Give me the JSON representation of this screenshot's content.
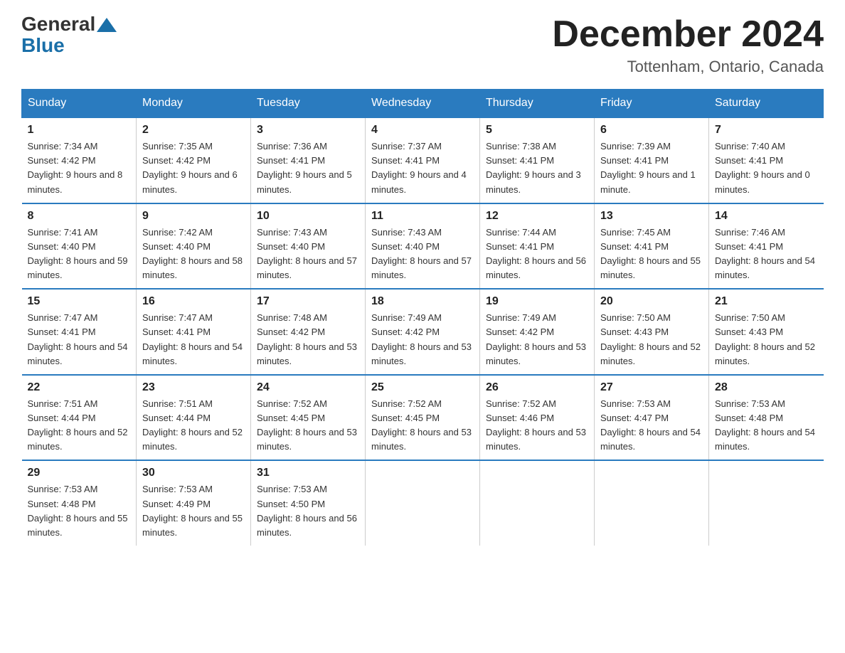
{
  "logo": {
    "general": "General",
    "blue": "Blue"
  },
  "title": "December 2024",
  "location": "Tottenham, Ontario, Canada",
  "days_of_week": [
    "Sunday",
    "Monday",
    "Tuesday",
    "Wednesday",
    "Thursday",
    "Friday",
    "Saturday"
  ],
  "weeks": [
    [
      {
        "day": "1",
        "sunrise": "7:34 AM",
        "sunset": "4:42 PM",
        "daylight": "9 hours and 8 minutes."
      },
      {
        "day": "2",
        "sunrise": "7:35 AM",
        "sunset": "4:42 PM",
        "daylight": "9 hours and 6 minutes."
      },
      {
        "day": "3",
        "sunrise": "7:36 AM",
        "sunset": "4:41 PM",
        "daylight": "9 hours and 5 minutes."
      },
      {
        "day": "4",
        "sunrise": "7:37 AM",
        "sunset": "4:41 PM",
        "daylight": "9 hours and 4 minutes."
      },
      {
        "day": "5",
        "sunrise": "7:38 AM",
        "sunset": "4:41 PM",
        "daylight": "9 hours and 3 minutes."
      },
      {
        "day": "6",
        "sunrise": "7:39 AM",
        "sunset": "4:41 PM",
        "daylight": "9 hours and 1 minute."
      },
      {
        "day": "7",
        "sunrise": "7:40 AM",
        "sunset": "4:41 PM",
        "daylight": "9 hours and 0 minutes."
      }
    ],
    [
      {
        "day": "8",
        "sunrise": "7:41 AM",
        "sunset": "4:40 PM",
        "daylight": "8 hours and 59 minutes."
      },
      {
        "day": "9",
        "sunrise": "7:42 AM",
        "sunset": "4:40 PM",
        "daylight": "8 hours and 58 minutes."
      },
      {
        "day": "10",
        "sunrise": "7:43 AM",
        "sunset": "4:40 PM",
        "daylight": "8 hours and 57 minutes."
      },
      {
        "day": "11",
        "sunrise": "7:43 AM",
        "sunset": "4:40 PM",
        "daylight": "8 hours and 57 minutes."
      },
      {
        "day": "12",
        "sunrise": "7:44 AM",
        "sunset": "4:41 PM",
        "daylight": "8 hours and 56 minutes."
      },
      {
        "day": "13",
        "sunrise": "7:45 AM",
        "sunset": "4:41 PM",
        "daylight": "8 hours and 55 minutes."
      },
      {
        "day": "14",
        "sunrise": "7:46 AM",
        "sunset": "4:41 PM",
        "daylight": "8 hours and 54 minutes."
      }
    ],
    [
      {
        "day": "15",
        "sunrise": "7:47 AM",
        "sunset": "4:41 PM",
        "daylight": "8 hours and 54 minutes."
      },
      {
        "day": "16",
        "sunrise": "7:47 AM",
        "sunset": "4:41 PM",
        "daylight": "8 hours and 54 minutes."
      },
      {
        "day": "17",
        "sunrise": "7:48 AM",
        "sunset": "4:42 PM",
        "daylight": "8 hours and 53 minutes."
      },
      {
        "day": "18",
        "sunrise": "7:49 AM",
        "sunset": "4:42 PM",
        "daylight": "8 hours and 53 minutes."
      },
      {
        "day": "19",
        "sunrise": "7:49 AM",
        "sunset": "4:42 PM",
        "daylight": "8 hours and 53 minutes."
      },
      {
        "day": "20",
        "sunrise": "7:50 AM",
        "sunset": "4:43 PM",
        "daylight": "8 hours and 52 minutes."
      },
      {
        "day": "21",
        "sunrise": "7:50 AM",
        "sunset": "4:43 PM",
        "daylight": "8 hours and 52 minutes."
      }
    ],
    [
      {
        "day": "22",
        "sunrise": "7:51 AM",
        "sunset": "4:44 PM",
        "daylight": "8 hours and 52 minutes."
      },
      {
        "day": "23",
        "sunrise": "7:51 AM",
        "sunset": "4:44 PM",
        "daylight": "8 hours and 52 minutes."
      },
      {
        "day": "24",
        "sunrise": "7:52 AM",
        "sunset": "4:45 PM",
        "daylight": "8 hours and 53 minutes."
      },
      {
        "day": "25",
        "sunrise": "7:52 AM",
        "sunset": "4:45 PM",
        "daylight": "8 hours and 53 minutes."
      },
      {
        "day": "26",
        "sunrise": "7:52 AM",
        "sunset": "4:46 PM",
        "daylight": "8 hours and 53 minutes."
      },
      {
        "day": "27",
        "sunrise": "7:53 AM",
        "sunset": "4:47 PM",
        "daylight": "8 hours and 54 minutes."
      },
      {
        "day": "28",
        "sunrise": "7:53 AM",
        "sunset": "4:48 PM",
        "daylight": "8 hours and 54 minutes."
      }
    ],
    [
      {
        "day": "29",
        "sunrise": "7:53 AM",
        "sunset": "4:48 PM",
        "daylight": "8 hours and 55 minutes."
      },
      {
        "day": "30",
        "sunrise": "7:53 AM",
        "sunset": "4:49 PM",
        "daylight": "8 hours and 55 minutes."
      },
      {
        "day": "31",
        "sunrise": "7:53 AM",
        "sunset": "4:50 PM",
        "daylight": "8 hours and 56 minutes."
      },
      null,
      null,
      null,
      null
    ]
  ]
}
